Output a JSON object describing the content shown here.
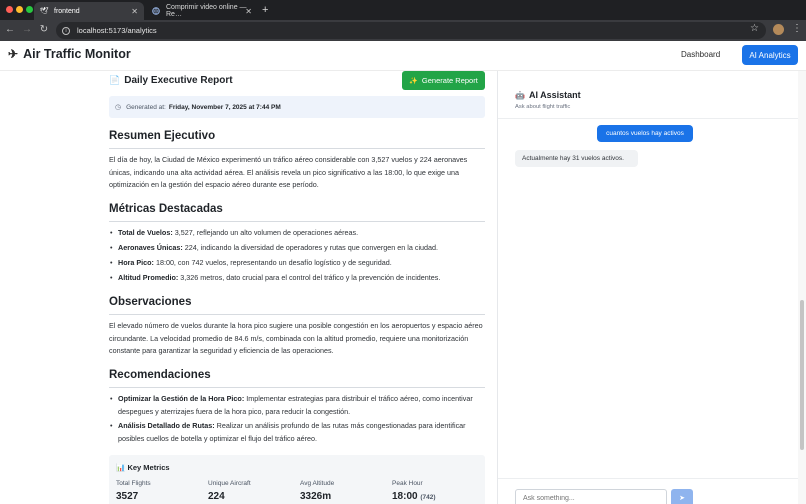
{
  "browser": {
    "tabs": [
      {
        "title": "frontend",
        "icon": "bird-icon"
      },
      {
        "title": "Comprimir video online — Re…",
        "icon": "globe-icon"
      }
    ],
    "new_tab_symbol": "+",
    "url": "localhost:5173/analytics"
  },
  "app": {
    "brand": "Air Traffic Monitor",
    "nav": {
      "dashboard": "Dashboard",
      "ai_analytics": "AI Analytics"
    },
    "accent_color": "#1a73e8"
  },
  "report": {
    "title": "Daily Executive Report",
    "generate_button": "Generate Report",
    "generated_label": "Generated at:",
    "generated_value": "Friday, November 7, 2025 at 7:44 PM",
    "sections": {
      "resumen": {
        "heading": "Resumen Ejecutivo",
        "text": "El día de hoy, la Ciudad de México experimentó un tráfico aéreo considerable con 3,527 vuelos y 224 aeronaves únicas, indicando una alta actividad aérea. El análisis revela un pico significativo a las 18:00, lo que exige una optimización en la gestión del espacio aéreo durante ese período."
      },
      "metricas": {
        "heading": "Métricas Destacadas",
        "items": [
          {
            "label": "Total de Vuelos:",
            "text": " 3,527, reflejando un alto volumen de operaciones aéreas."
          },
          {
            "label": "Aeronaves Únicas:",
            "text": " 224, indicando la diversidad de operadores y rutas que convergen en la ciudad."
          },
          {
            "label": "Hora Pico:",
            "text": " 18:00, con 742 vuelos, representando un desafío logístico y de seguridad."
          },
          {
            "label": "Altitud Promedio:",
            "text": " 3,326 metros, dato crucial para el control del tráfico y la prevención de incidentes."
          }
        ]
      },
      "observaciones": {
        "heading": "Observaciones",
        "text": "El elevado número de vuelos durante la hora pico sugiere una posible congestión en los aeropuertos y espacio aéreo circundante. La velocidad promedio de 84.6 m/s, combinada con la altitud promedio, requiere una monitorización constante para garantizar la seguridad y eficiencia de las operaciones."
      },
      "recomendaciones": {
        "heading": "Recomendaciones",
        "items": [
          {
            "label": "Optimizar la Gestión de la Hora Pico:",
            "text": " Implementar estrategias para distribuir el tráfico aéreo, como incentivar despegues y aterrizajes fuera de la hora pico, para reducir la congestión."
          },
          {
            "label": "Análisis Detallado de Rutas:",
            "text": " Realizar un análisis profundo de las rutas más congestionadas para identificar posibles cuellos de botella y optimizar el flujo del tráfico aéreo."
          }
        ]
      }
    },
    "key_metrics": {
      "title": "Key Metrics",
      "items": [
        {
          "label": "Total Flights",
          "value": "3527",
          "extra": ""
        },
        {
          "label": "Unique Aircraft",
          "value": "224",
          "extra": ""
        },
        {
          "label": "Avg Altitude",
          "value": "3326m",
          "extra": ""
        },
        {
          "label": "Peak Hour",
          "value": "18:00",
          "extra": "(742)"
        }
      ]
    }
  },
  "assistant": {
    "title": "AI Assistant",
    "subtitle": "Ask about flight traffic",
    "messages": [
      {
        "role": "user",
        "text": "cuantos vuelos hay activos"
      },
      {
        "role": "assistant",
        "text": "Actualmente hay 31 vuelos activos."
      }
    ],
    "input_placeholder": "Ask something...",
    "send_symbol": "➤"
  }
}
